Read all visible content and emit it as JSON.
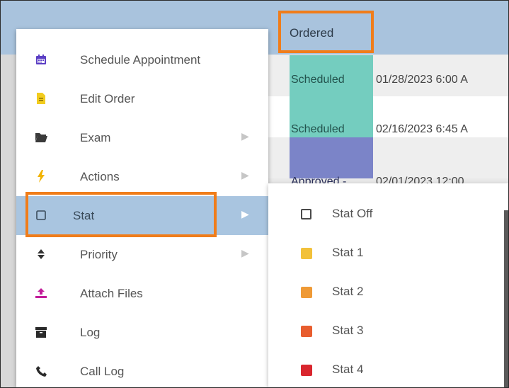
{
  "header": {
    "left_text": "…",
    "column": "Ordered"
  },
  "rows": [
    {
      "status": "Scheduled",
      "date": "01/28/2023 6:00 A",
      "status_color": "#74cdbf"
    },
    {
      "status": "Scheduled",
      "date": "02/16/2023 6:45 A",
      "status_color": "#74cdbf"
    },
    {
      "status": "Approved -",
      "date": "02/01/2023 12:00",
      "status_color": "#7b84c8"
    }
  ],
  "context_menu": {
    "items": [
      {
        "label": "Schedule Appointment",
        "icon": "calendar-icon"
      },
      {
        "label": "Edit Order",
        "icon": "document-icon"
      },
      {
        "label": "Exam",
        "icon": "folder-open-icon",
        "submenu": true
      },
      {
        "label": "Actions",
        "icon": "lightning-icon",
        "submenu": true
      },
      {
        "label": "Stat",
        "icon": "checkbox-icon",
        "submenu": true,
        "active": true
      },
      {
        "label": "Priority",
        "icon": "sort-icon",
        "submenu": true
      },
      {
        "label": "Attach Files",
        "icon": "upload-icon"
      },
      {
        "label": "Log",
        "icon": "archive-icon"
      },
      {
        "label": "Call Log",
        "icon": "phone-icon"
      }
    ]
  },
  "stat_submenu": {
    "items": [
      {
        "label": "Stat Off",
        "color": "none"
      },
      {
        "label": "Stat 1",
        "color": "#f2c13a"
      },
      {
        "label": "Stat 2",
        "color": "#ef9a36"
      },
      {
        "label": "Stat 3",
        "color": "#e85d2e"
      },
      {
        "label": "Stat 4",
        "color": "#d9262e"
      }
    ]
  },
  "colors": {
    "header": "#a9c3dd",
    "highlight_border": "#f07d1a",
    "active_item": "#a9c5e0"
  }
}
